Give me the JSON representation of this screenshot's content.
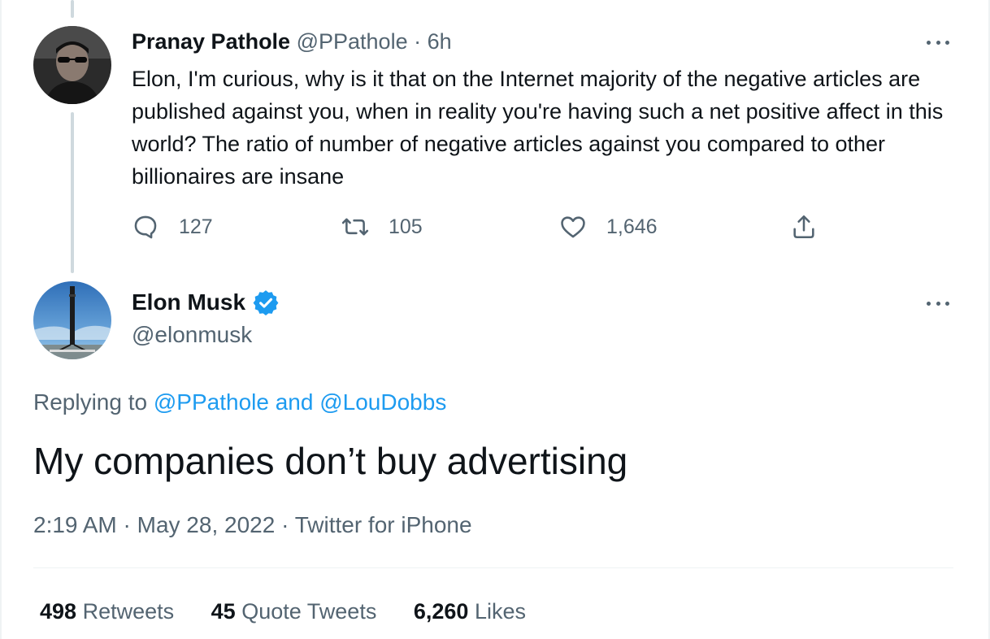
{
  "parent_tweet": {
    "author_name": "Pranay Pathole",
    "author_handle": "@PPathole",
    "separator": "·",
    "time": "6h",
    "text": "Elon, I'm curious, why is it that on the Internet majority of the negative articles are published against you, when in reality you're having such a net positive affect in this world? The ratio of number of negative articles against you compared to other billionaires are insane",
    "replies": "127",
    "retweets": "105",
    "likes": "1,646",
    "icons": [
      "reply-icon",
      "retweet-icon",
      "like-icon",
      "share-icon",
      "more-icon"
    ]
  },
  "main_tweet": {
    "author_name": "Elon Musk",
    "author_handle": "@elonmusk",
    "verified": true,
    "replying_prefix": "Replying to",
    "replying_to_1": "@PPathole",
    "replying_and": "and",
    "replying_to_2": "@LouDobbs",
    "text": "My companies don’t buy advertising",
    "time": "2:19 AM",
    "date": "May 28, 2022",
    "source": "Twitter for iPhone",
    "separator": "·",
    "stats": {
      "retweets_count": "498",
      "retweets_label": "Retweets",
      "quotes_count": "45",
      "quotes_label": "Quote Tweets",
      "likes_count": "6,260",
      "likes_label": "Likes"
    }
  },
  "colors": {
    "text": "#0f1419",
    "secondary": "#536471",
    "link": "#1d9bf0",
    "verified": "#1d9bf0",
    "thread_line": "#cfd9de"
  }
}
